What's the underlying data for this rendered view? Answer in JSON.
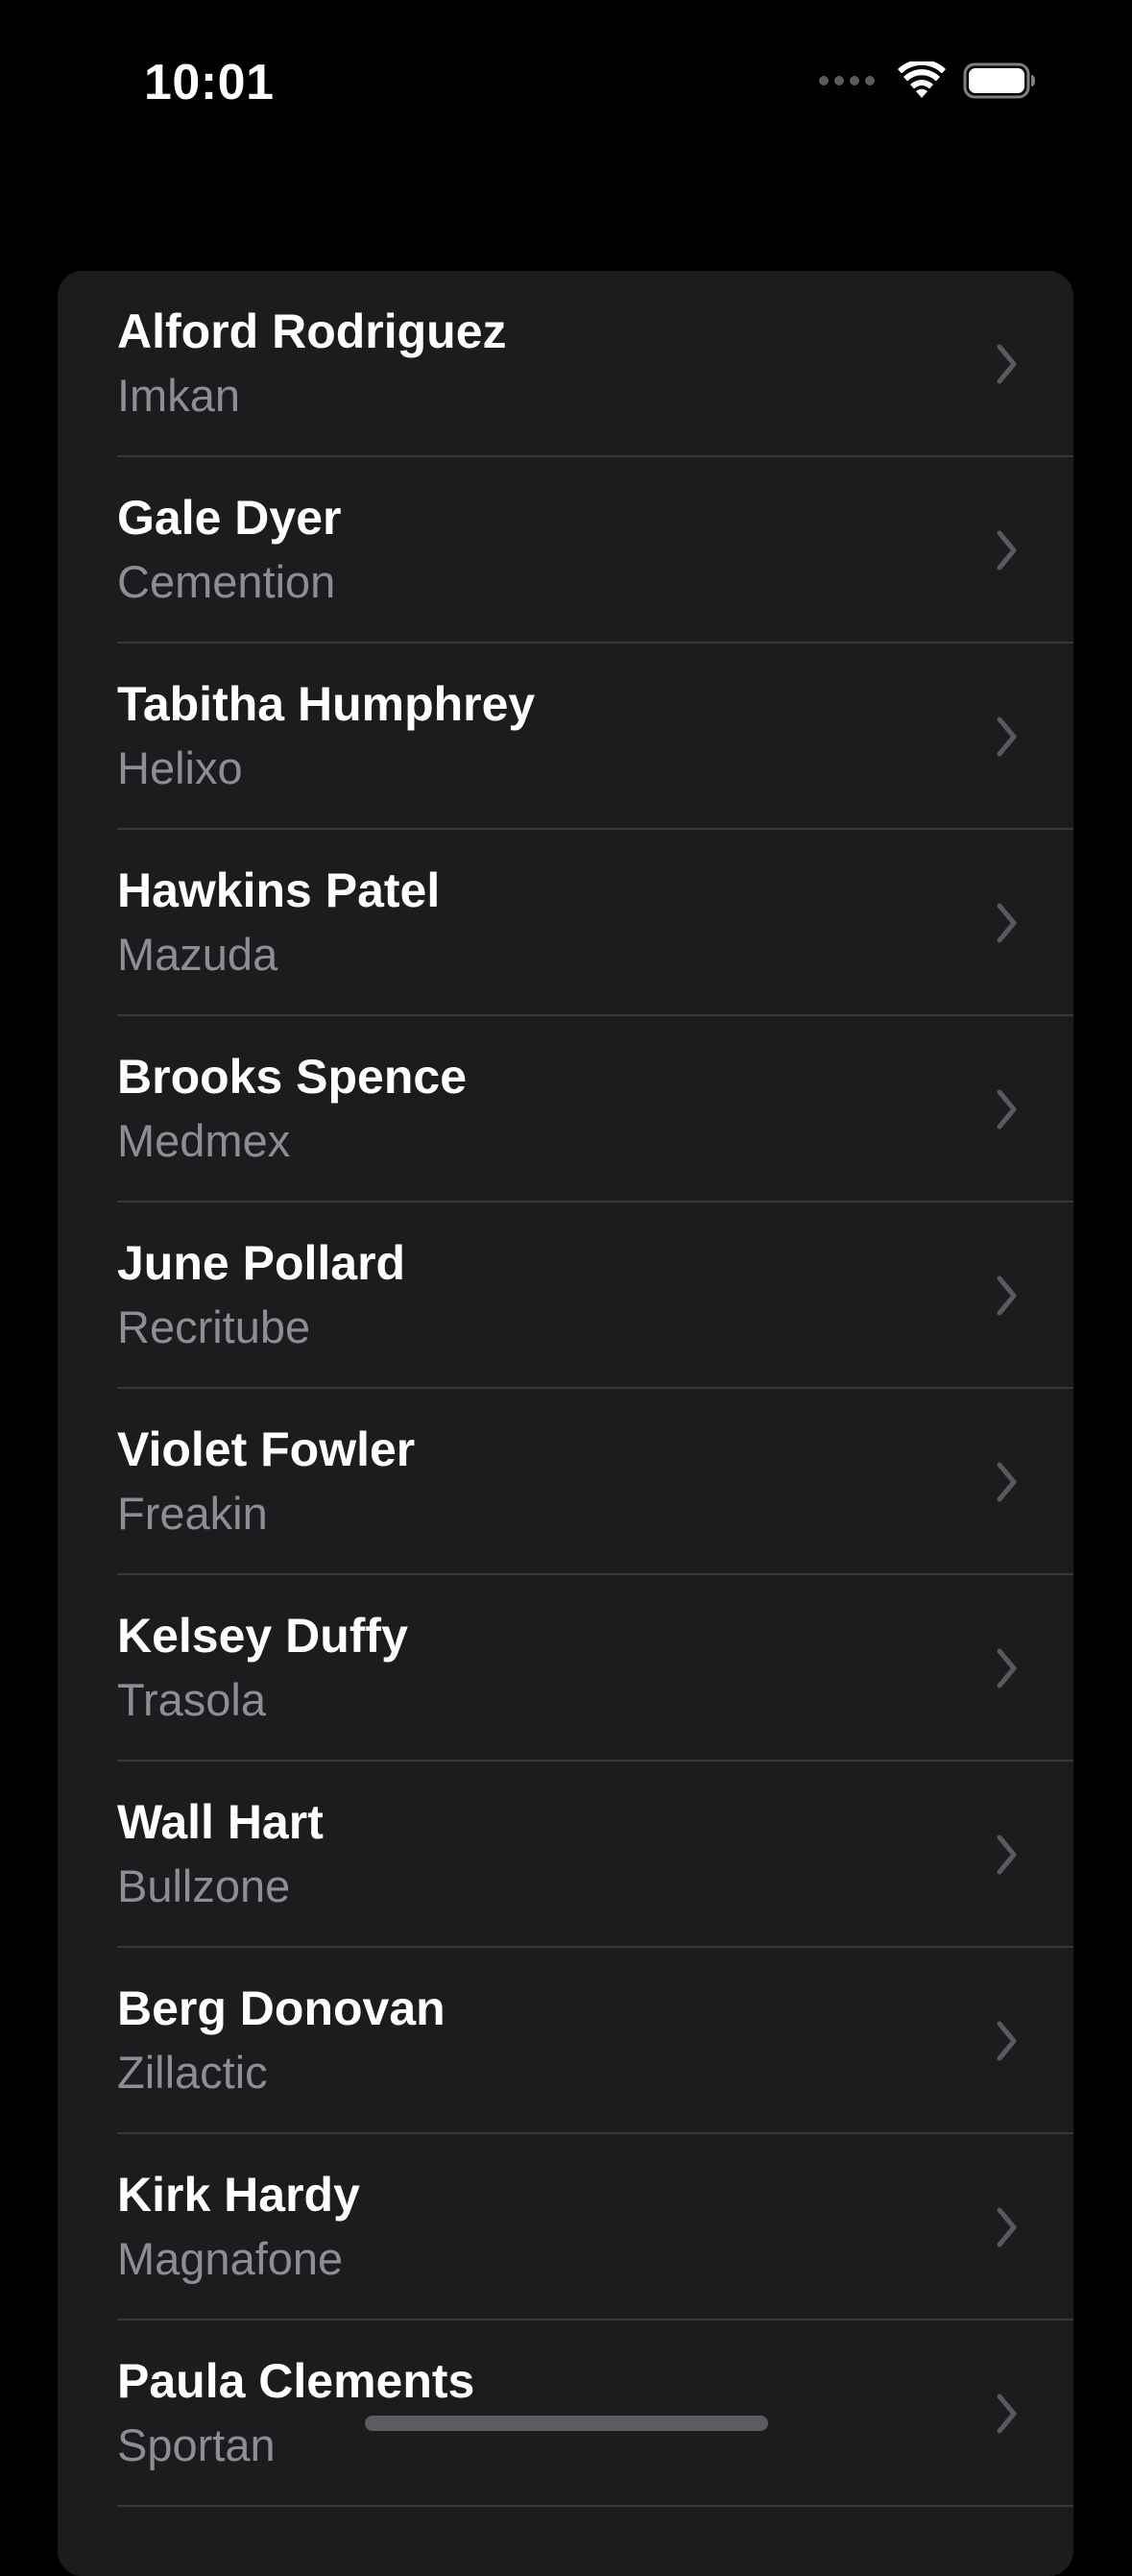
{
  "status_bar": {
    "time": "10:01",
    "icons": [
      "cellular-signal-icon",
      "wifi-icon",
      "battery-icon"
    ]
  },
  "contacts": [
    {
      "name": "Alford Rodriguez",
      "company": "Imkan"
    },
    {
      "name": "Gale Dyer",
      "company": "Cemention"
    },
    {
      "name": "Tabitha Humphrey",
      "company": "Helixo"
    },
    {
      "name": "Hawkins Patel",
      "company": "Mazuda"
    },
    {
      "name": "Brooks Spence",
      "company": "Medmex"
    },
    {
      "name": "June Pollard",
      "company": "Recritube"
    },
    {
      "name": "Violet Fowler",
      "company": "Freakin"
    },
    {
      "name": "Kelsey Duffy",
      "company": "Trasola"
    },
    {
      "name": "Wall Hart",
      "company": "Bullzone"
    },
    {
      "name": "Berg Donovan",
      "company": "Zillactic"
    },
    {
      "name": "Kirk Hardy",
      "company": "Magnafone"
    },
    {
      "name": "Paula Clements",
      "company": "Sportan"
    }
  ],
  "colors": {
    "background": "#000000",
    "card": "#1c1c1e",
    "primary_text": "#ffffff",
    "secondary_text": "#8d8d93",
    "separator": "#38383a",
    "chevron": "#5a5a5e"
  }
}
